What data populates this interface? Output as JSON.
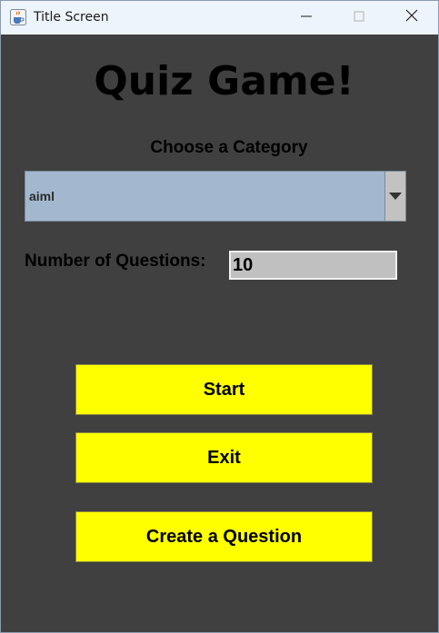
{
  "window": {
    "title": "Title Screen",
    "app_icon": "java-cup-icon",
    "controls": [
      "minimize-icon",
      "maximize-icon",
      "close-icon"
    ]
  },
  "main": {
    "heading": "Quiz Game!",
    "category_label": "Choose a Category",
    "category_selected": "aiml",
    "num_questions_label": "Number of Questions:",
    "num_questions_value": "10"
  },
  "buttons": {
    "start": "Start",
    "exit": "Exit",
    "create": "Create a Question"
  },
  "colors": {
    "background": "#404040",
    "button": "#ffff00",
    "combo": "#a3b8cf",
    "input": "#c0c0c0"
  }
}
